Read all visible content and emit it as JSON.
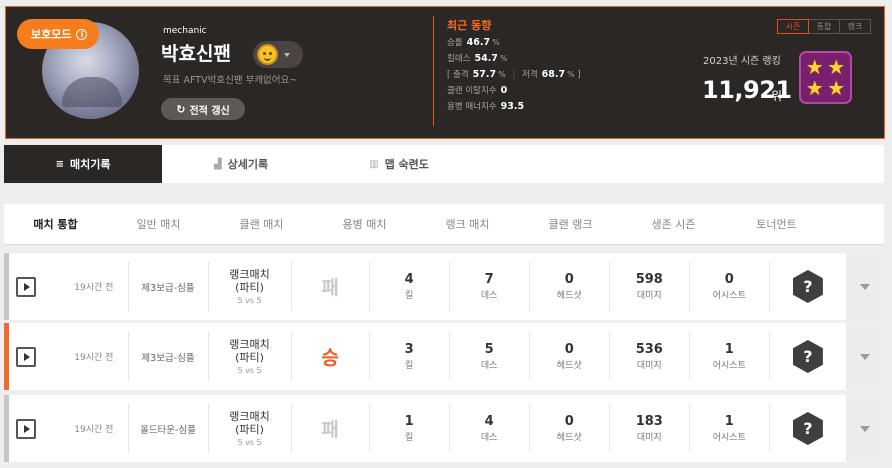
{
  "profile": {
    "protect_badge": "보호모드",
    "protect_info_icon": "i",
    "job": "mechanic",
    "nickname": "박효신팬",
    "status_message": "목표 AFTV박효신팬 부캐없어요~",
    "refresh_button": "전적 갱신",
    "refresh_icon": "↻"
  },
  "trend": {
    "title": "최근 동향",
    "win_rate": {
      "label": "승률",
      "value": "46.7",
      "unit": "%"
    },
    "kill_rate": {
      "label": "킬데스",
      "value": "54.7",
      "unit": "%"
    },
    "shot_rate": {
      "label": "출격",
      "value": "57.7",
      "unit": "%"
    },
    "snipe_rate": {
      "label": "저격",
      "value": "68.7",
      "unit": "%"
    },
    "bracket_open": "[",
    "bracket_close": "]",
    "separator": "|",
    "leave_count": {
      "label": "클랜 이탈지수",
      "value": "0"
    },
    "manner": {
      "label": "용병 매너지수",
      "value": "93.5"
    }
  },
  "season": {
    "tabs": [
      {
        "label": "시즌",
        "active": true
      },
      {
        "label": "통합",
        "active": false
      },
      {
        "label": "랭크",
        "active": false
      }
    ],
    "label": "2023년 시즌 랭킹",
    "rank": "11,921",
    "rank_unit": "위",
    "star_glyph": "★"
  },
  "main_tabs": [
    {
      "label": "매치기록",
      "icon": "≡",
      "active": true
    },
    {
      "label": "상세기록",
      "icon": "▟",
      "active": false
    },
    {
      "label": "맵 숙련도",
      "icon": "▥",
      "active": false
    }
  ],
  "sub_tabs": [
    "매치 통합",
    "일반 매치",
    "클랜 매치",
    "용병 매치",
    "랭크 매치",
    "클랜 랭크",
    "생존 시즌",
    "토너먼트"
  ],
  "matches": [
    {
      "time": "19시간 전",
      "map": "제3보급-심플",
      "mode": "랭크매치",
      "mode_sub": "(파티)",
      "size": "5 vs 5",
      "result": "패",
      "win": false,
      "kill": "4",
      "death": "7",
      "headshot": "0",
      "damage": "598",
      "assist": "0"
    },
    {
      "time": "19시간 전",
      "map": "제3보급-심플",
      "mode": "랭크매치",
      "mode_sub": "(파티)",
      "size": "5 vs 5",
      "result": "승",
      "win": true,
      "kill": "3",
      "death": "5",
      "headshot": "0",
      "damage": "536",
      "assist": "1"
    },
    {
      "time": "19시간 전",
      "map": "올드타운-심플",
      "mode": "랭크매치",
      "mode_sub": "(파티)",
      "size": "5 vs 5",
      "result": "패",
      "win": false,
      "kill": "1",
      "death": "4",
      "headshot": "0",
      "damage": "183",
      "assist": "1"
    }
  ],
  "stat_labels": {
    "kill": "킬",
    "death": "데스",
    "headshot": "헤드샷",
    "damage": "대미지",
    "assist": "어시스트"
  },
  "weapon_unknown": "?",
  "colors": {
    "accent": "#f57d1e",
    "win": "#f06a2e",
    "header_bg": "#2b2725"
  }
}
